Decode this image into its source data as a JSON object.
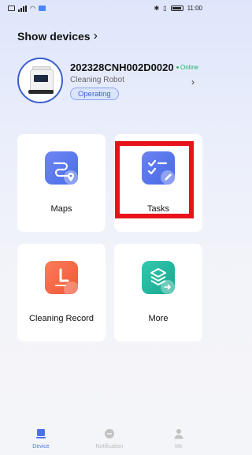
{
  "status_bar": {
    "time": "11:00"
  },
  "header": {
    "title": "Show devices",
    "chevron": "›"
  },
  "device": {
    "name": "202328CNH002D0020",
    "online_text": "Online",
    "type": "Cleaning Robot",
    "status": "Operating",
    "chevron": "›"
  },
  "cards": [
    {
      "label": "Maps",
      "icon": "map-route-icon"
    },
    {
      "label": "Tasks",
      "icon": "task-checklist-icon"
    },
    {
      "label": "Cleaning Record",
      "icon": "clock-icon"
    },
    {
      "label": "More",
      "icon": "layers-icon"
    }
  ],
  "tabbar": {
    "items": [
      {
        "label": "Device",
        "icon": "device-icon"
      },
      {
        "label": "Notification",
        "icon": "message-icon"
      },
      {
        "label": "Me",
        "icon": "person-icon"
      }
    ]
  },
  "colors": {
    "accent": "#4a72e6",
    "online": "#20b26b",
    "highlight": "#e8121b"
  }
}
